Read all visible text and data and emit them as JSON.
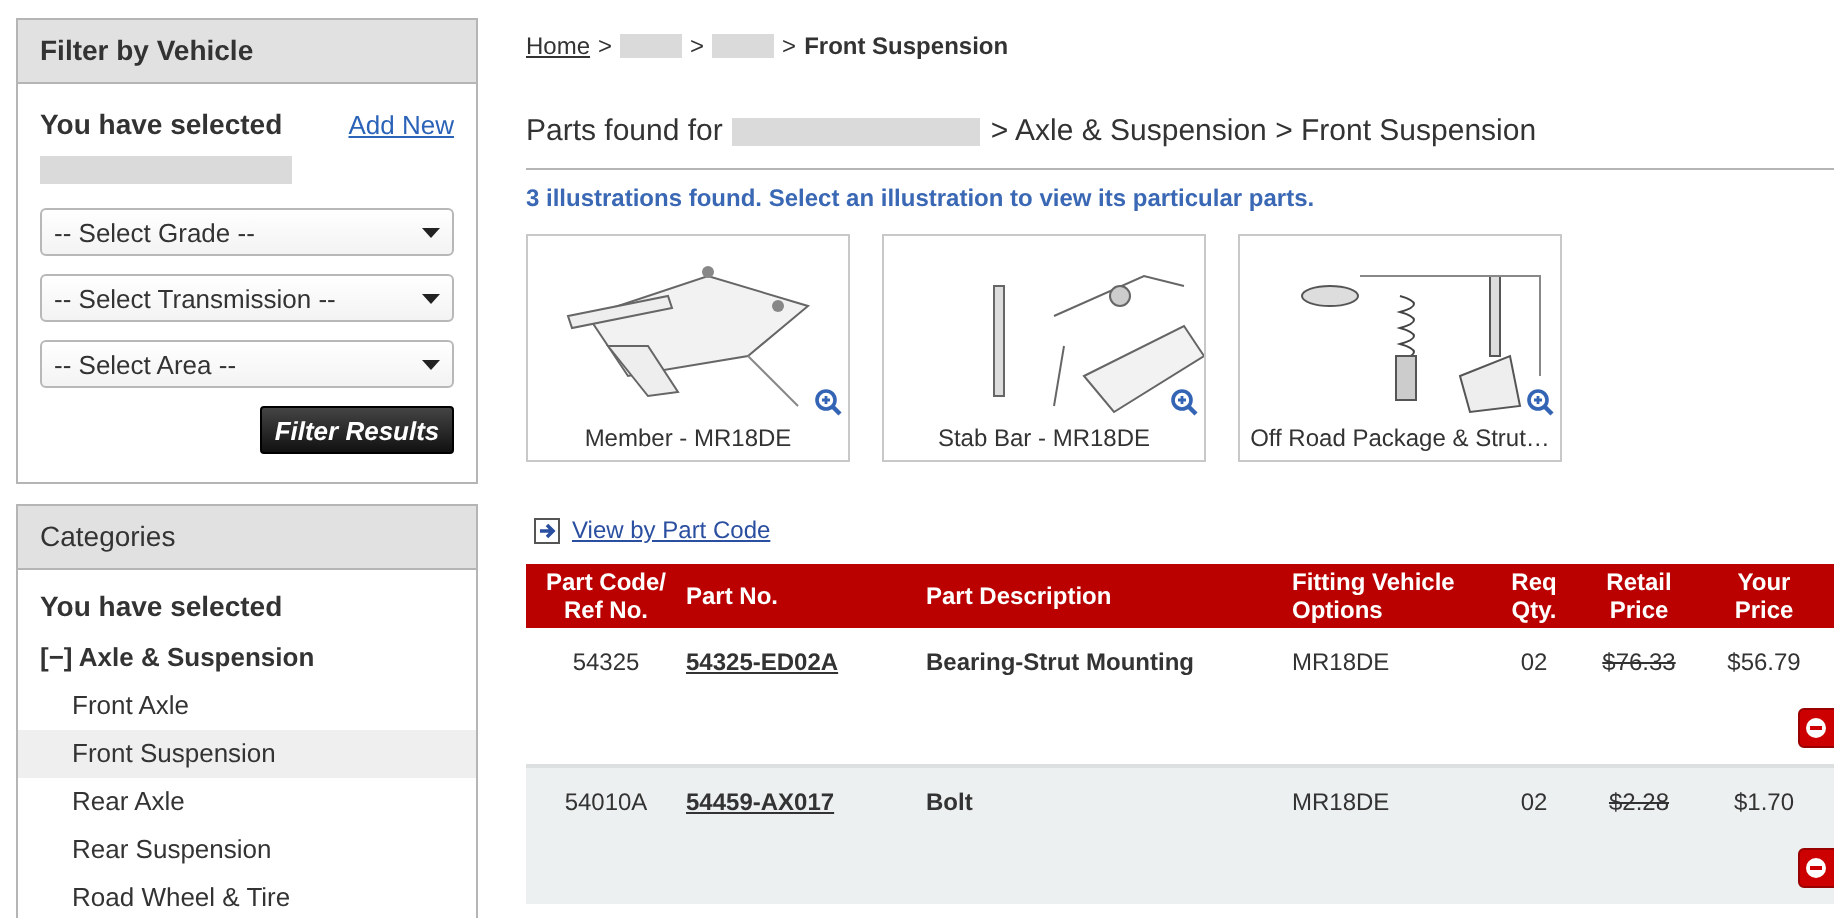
{
  "filter_panel": {
    "title": "Filter by Vehicle",
    "selected_label": "You have selected",
    "add_new": "Add New",
    "selects": [
      {
        "placeholder": "-- Select Grade --"
      },
      {
        "placeholder": "-- Select Transmission --"
      },
      {
        "placeholder": "-- Select Area --"
      }
    ],
    "button": "Filter Results"
  },
  "categories_panel": {
    "title": "Categories",
    "selected_label": "You have selected",
    "tree": [
      {
        "label": "Axle & Suspension",
        "toggle": "[−]",
        "expanded": true,
        "children": [
          {
            "label": "Front Axle",
            "selected": false
          },
          {
            "label": "Front Suspension",
            "selected": true
          },
          {
            "label": "Rear Axle",
            "selected": false
          },
          {
            "label": "Rear Suspension",
            "selected": false
          },
          {
            "label": "Road Wheel & Tire",
            "selected": false
          }
        ]
      }
    ]
  },
  "breadcrumb": [
    {
      "kind": "link",
      "label": "Home"
    },
    {
      "kind": "hidden"
    },
    {
      "kind": "hidden"
    },
    {
      "kind": "current",
      "label": "Front Suspension"
    }
  ],
  "breadcrumb_separator": ">",
  "heading": {
    "prefix": "Parts found for",
    "suffix": "> Axle & Suspension > Front Suspension"
  },
  "illustrations_note": "3 illustrations found. Select an illustration to view its particular parts.",
  "illustrations": [
    {
      "caption": "Member - MR18DE",
      "kind": "picture"
    },
    {
      "caption": "Stab Bar - MR18DE",
      "kind": "picture"
    },
    {
      "caption": "Off Road Package & Strut…",
      "kind": "picture"
    }
  ],
  "view_link": "View by Part Code",
  "table": {
    "columns": [
      "Part Code/ Ref No.",
      "Part No.",
      "Part Description",
      "Fitting Vehicle Options",
      "Req Qty.",
      "Retail Price",
      "Your Price"
    ],
    "rows": [
      {
        "code": "54325",
        "part_no": "54325-ED02A",
        "description": "Bearing-Strut Mounting",
        "options": "MR18DE",
        "qty": "02",
        "retail": "$76.33",
        "price": "$56.79"
      },
      {
        "code": "54010A",
        "part_no": "54459-AX017",
        "description": "Bolt",
        "options": "MR18DE",
        "qty": "02",
        "retail": "$2.28",
        "price": "$1.70"
      }
    ]
  }
}
